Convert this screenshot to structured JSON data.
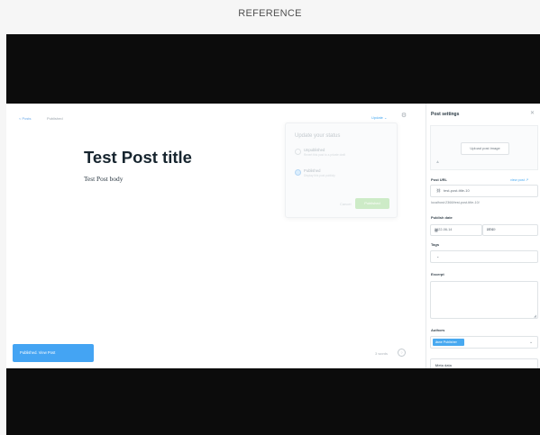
{
  "reference_label": "REFERENCE",
  "editor": {
    "crumb_back": "< Posts",
    "crumb_state": "Published",
    "updated_label": "Update ⌄",
    "settings_icon": "gear-icon",
    "post_title": "Test Post title",
    "post_body": "Test Post body",
    "word_count": "3 words",
    "help_icon": "question-icon",
    "publish_note": "Published. View Post"
  },
  "status_popup": {
    "title": "Update your status",
    "options": [
      {
        "label": "Unpublished",
        "desc": "Revert this post to a private draft",
        "selected": false
      },
      {
        "label": "Published",
        "desc": "Display this post publicly",
        "selected": true
      }
    ],
    "cancel": "Cancel",
    "update": "Published"
  },
  "sidebar": {
    "title": "Post settings",
    "close_icon": "close-icon",
    "upload_label": "Upload post image",
    "image_icon": "image-icon",
    "post_url_label": "Post URL",
    "view_post_label": "view post ↗",
    "post_url_value": "test-post-title-10",
    "url_preview": "localhost:2368/test-post-title-10/",
    "publish_date_label": "Publish date",
    "date_value": "2022-06-14",
    "time_value": "20:49",
    "tz_value": "UTC",
    "tags_label": "Tags",
    "excerpt_label": "Excerpt",
    "authors_label": "Authors",
    "author_name": "Jane Publisher",
    "meta_data_label": "Meta data"
  },
  "colors": {
    "accent": "#48a9f0",
    "publish_note": "#44a4f3",
    "update_button": "#cdebc7",
    "letterbox": "#0c0c0c"
  }
}
